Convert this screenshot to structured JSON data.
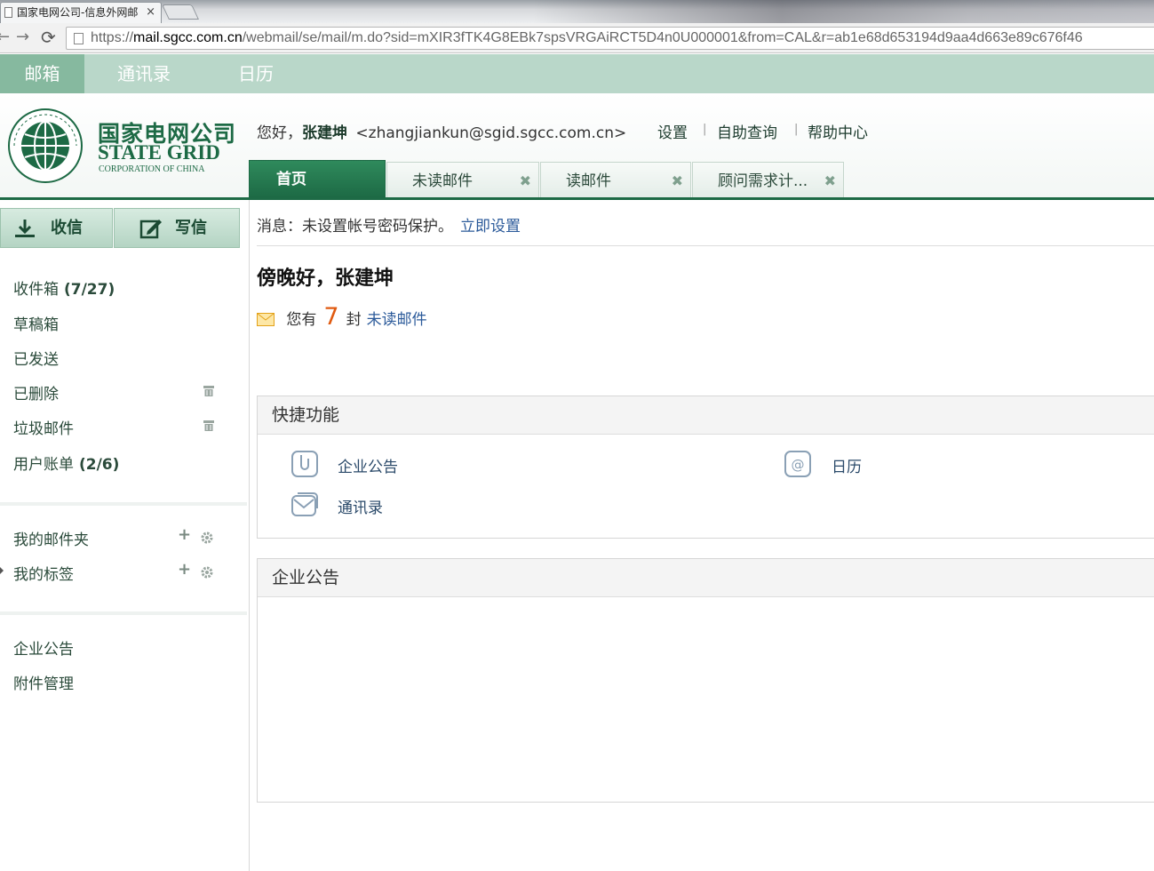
{
  "browser": {
    "tab_title": "国家电网公司-信息外网邮",
    "tab_close": "×",
    "url_prefix": "https://",
    "url_host": "mail.sgcc.com.cn",
    "url_path": "/webmail/se/mail/m.do?sid=mXIR3fTK4G8EBk7spsVRGAiRCT5D4n0U000001&from=CAL&r=ab1e68d653194d9aa4d663e89c676f46"
  },
  "appnav": [
    "邮箱",
    "通讯录",
    "日历"
  ],
  "logo": {
    "cn": "国家电网公司",
    "en": "STATE GRID",
    "sub": "CORPORATION OF CHINA"
  },
  "header": {
    "greeting": "您好，",
    "user_name": "张建坤",
    "email": "<zhangjiankun@sgid.sgcc.com.cn>",
    "links": [
      "设置",
      "自助查询",
      "帮助中心"
    ],
    "separator": "|"
  },
  "tabs": {
    "home": "首页",
    "items": [
      "未读邮件",
      "读邮件",
      "顾问需求计..."
    ],
    "close": "✖"
  },
  "sidebar": {
    "receive": "收信",
    "compose": "写信",
    "folders": [
      {
        "label": "收件箱",
        "count": "(7/27)"
      },
      {
        "label": "草稿箱",
        "count": ""
      },
      {
        "label": "已发送",
        "count": ""
      },
      {
        "label": "已删除",
        "count": ""
      },
      {
        "label": "垃圾邮件",
        "count": ""
      },
      {
        "label": "用户账单",
        "count": "(2/6)"
      }
    ],
    "my_folders": "我的邮件夹",
    "my_tags": "我的标签",
    "plus": "+",
    "links": [
      "企业公告",
      "附件管理"
    ]
  },
  "main": {
    "message_prefix": "消息：未设置帐号密码保护。",
    "message_link": "立即设置",
    "welcome": "傍晚好，张建坤",
    "unread_prefix": "您有",
    "unread_count": "7",
    "unread_unit": "封",
    "unread_link": "未读邮件",
    "quick_title": "快捷功能",
    "quick_items": [
      "企业公告",
      "日历",
      "通讯录"
    ],
    "notice_title": "企业公告"
  },
  "colors": {
    "brand": "#1d6a45",
    "nav_bg": "#b9d7c9",
    "link": "#2b5a9a",
    "unread_number": "#e05a10"
  }
}
